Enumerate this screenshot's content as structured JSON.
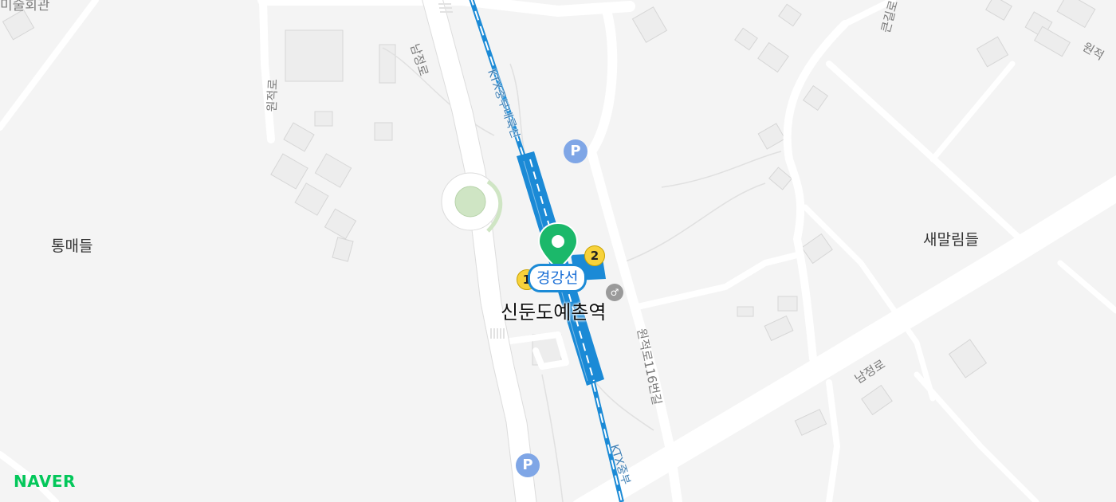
{
  "map": {
    "station_name": "신둔도예촌역",
    "line_badge": "경강선",
    "exits": [
      "1",
      "2"
    ],
    "parking_symbol": "P",
    "area_labels": {
      "tongmaedeul": "통매들",
      "saemallimdeul": "새말림들",
      "top_left_partial": "미술회관"
    },
    "road_labels": {
      "namjeongro_west": "남정로",
      "namjeongro_east": "남정로",
      "wonjeokro_west": "원적로",
      "wonjeokro_116": "원적로116번길",
      "ktx_rail_north": "KTX중부내륙선",
      "ktx_rail_south": "KTX중부",
      "top_right_partial": "원적",
      "top_right_vertical": "큰길로"
    },
    "icons": {
      "marker": "location-pin-icon",
      "toilet": "restroom-icon",
      "parking": "parking-icon"
    },
    "colors": {
      "rail": "#1b8ad6",
      "marker": "#1bb86a",
      "exit": "#f7d23a",
      "parking": "#7fa6e6"
    }
  },
  "brand": {
    "logo": "NAVER"
  }
}
